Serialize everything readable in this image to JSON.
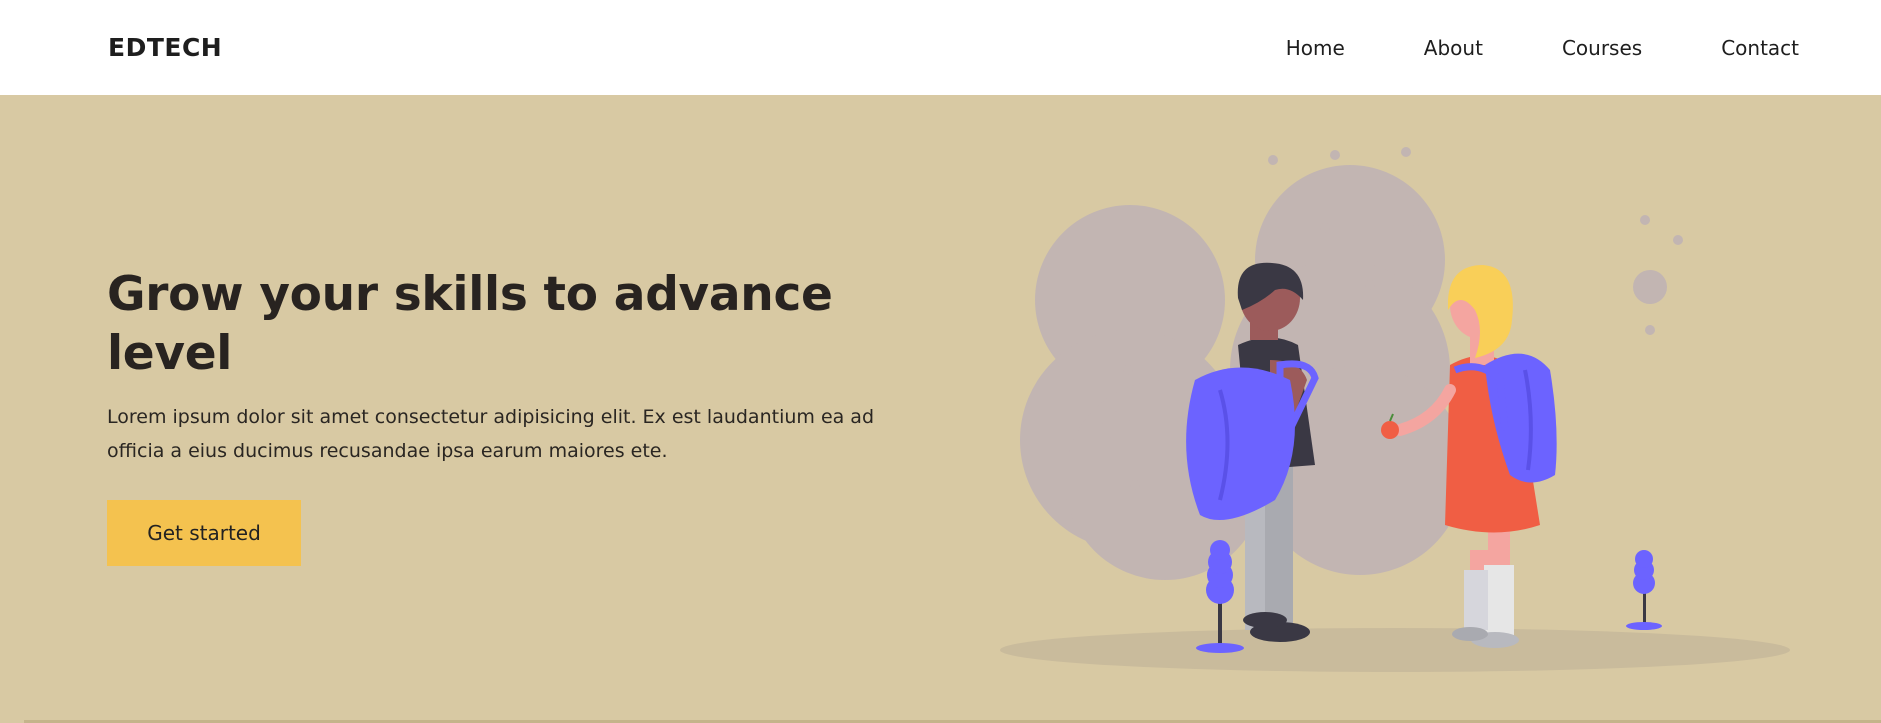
{
  "header": {
    "brand": "EDTECH",
    "nav": [
      {
        "label": "Home"
      },
      {
        "label": "About"
      },
      {
        "label": "Courses"
      },
      {
        "label": "Contact"
      }
    ]
  },
  "hero": {
    "title": "Grow your skills to advance level",
    "text": "Lorem ipsum dolor sit amet consectetur adipisicing elit. Ex est laudantium ea ad officia a eius ducimus recusandae ipsa earum maiores ete.",
    "button_label": "Get started"
  },
  "colors": {
    "hero_background": "#d8c9a3",
    "button": "#f4c24f",
    "illustration_accent": "#6c63ff"
  }
}
